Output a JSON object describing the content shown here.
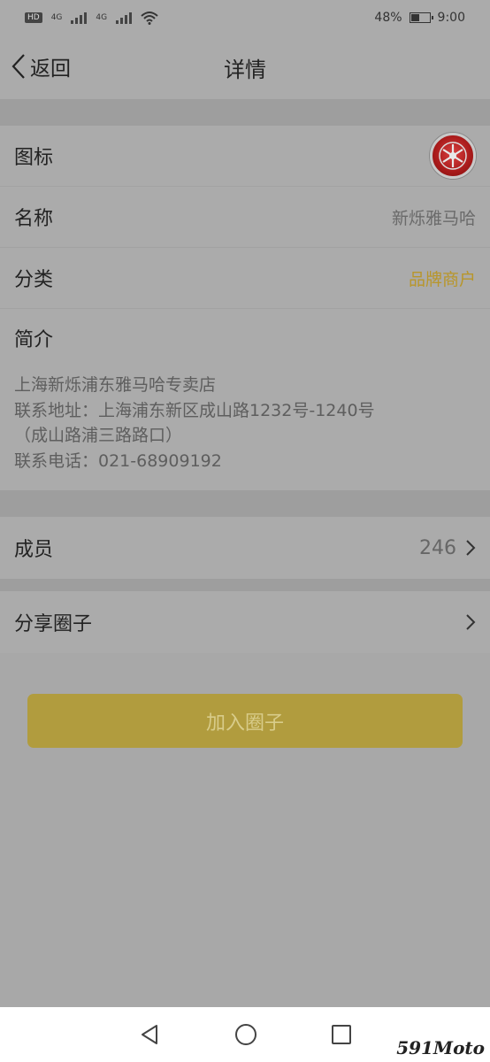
{
  "status_bar": {
    "battery": "48%",
    "time": "9:00",
    "net1": "4G",
    "net2": "4G"
  },
  "nav": {
    "back_label": "返回",
    "title": "详情"
  },
  "details": {
    "icon_label": "图标",
    "name_label": "名称",
    "name_value": "新烁雅马哈",
    "category_label": "分类",
    "category_value": "品牌商户",
    "intro_label": "简介",
    "intro_lines": [
      "上海新烁浦东雅马哈专卖店",
      "联系地址：上海浦东新区成山路1232号-1240号",
      "（成山路浦三路路口）",
      "联系电话：021-68909192"
    ]
  },
  "members": {
    "label": "成员",
    "count": "246"
  },
  "share": {
    "label": "分享圈子"
  },
  "join_button": {
    "label": "加入圈子"
  },
  "watermark": "591Moto",
  "colors": {
    "accent": "#b8962a",
    "button": "#b19c3e"
  }
}
